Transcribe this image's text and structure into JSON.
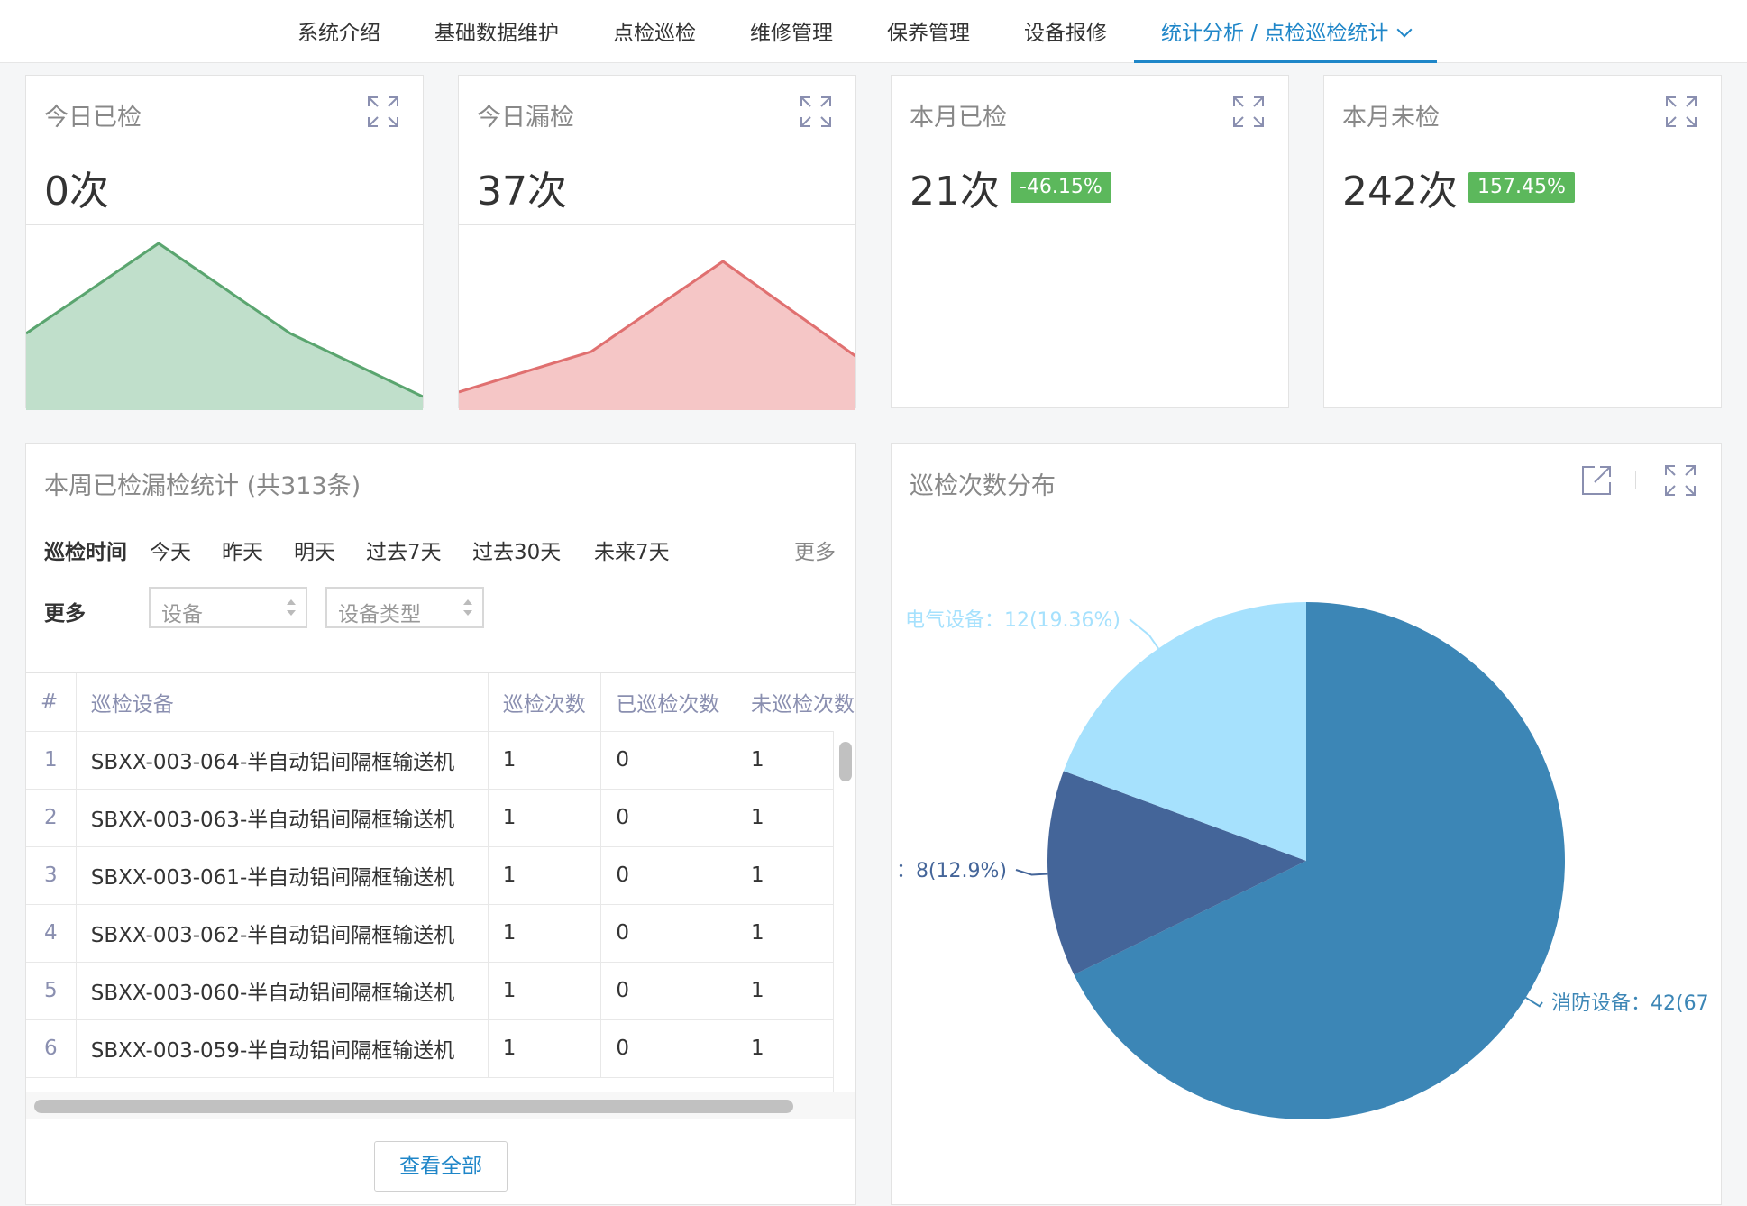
{
  "nav": {
    "items": [
      "系统介绍",
      "基础数据维护",
      "点检巡检",
      "维修管理",
      "保养管理",
      "设备报修"
    ],
    "active": "统计分析 / 点检巡检统计"
  },
  "stats": [
    {
      "title": "今日已检",
      "value": "0次",
      "badge": ""
    },
    {
      "title": "今日漏检",
      "value": "37次",
      "badge": ""
    },
    {
      "title": "本月已检",
      "value": "21次",
      "badge": "-46.15%"
    },
    {
      "title": "本月未检",
      "value": "242次",
      "badge": "157.45%"
    }
  ],
  "colors": {
    "accent": "#1f86c8",
    "spark_green_line": "#5aa56f",
    "spark_green_fill": "#c0dfcb",
    "spark_red_line": "#e07070",
    "spark_red_fill": "#f5c6c6",
    "badge": "#5cb85c",
    "pie_fire": "#3c86b6",
    "pie_electric": "#a6e1fd",
    "pie_other": "#446599"
  },
  "table": {
    "title": "本周已检漏检统计 (共313条)",
    "filter_time_label": "巡检时间",
    "filter_time_options": [
      "今天",
      "昨天",
      "明天",
      "过去7天",
      "过去30天",
      "未来7天"
    ],
    "filter_more_link": "更多",
    "filter_more_label": "更多",
    "select_device_placeholder": "设备",
    "select_type_placeholder": "设备类型",
    "headers": [
      "#",
      "巡检设备",
      "巡检次数",
      "已巡检次数",
      "未巡检次数"
    ],
    "rows": [
      [
        "1",
        "SBXX-003-064-半自动铝间隔框输送机",
        "1",
        "0",
        "1"
      ],
      [
        "2",
        "SBXX-003-063-半自动铝间隔框输送机",
        "1",
        "0",
        "1"
      ],
      [
        "3",
        "SBXX-003-061-半自动铝间隔框输送机",
        "1",
        "0",
        "1"
      ],
      [
        "4",
        "SBXX-003-062-半自动铝间隔框输送机",
        "1",
        "0",
        "1"
      ],
      [
        "5",
        "SBXX-003-060-半自动铝间隔框输送机",
        "1",
        "0",
        "1"
      ],
      [
        "6",
        "SBXX-003-059-半自动铝间隔框输送机",
        "1",
        "0",
        "1"
      ]
    ],
    "view_all": "查看全部"
  },
  "pie_card": {
    "title": "巡检次数分布"
  },
  "chart_data": {
    "type": "pie",
    "slices": [
      {
        "name": "消防设备",
        "value": 42,
        "label": "消防设备：42(67"
      },
      {
        "name": "",
        "value": 8,
        "label": "：8(12.9%)"
      },
      {
        "name": "电气设备",
        "value": 12,
        "label": "电气设备：12(19.36%)"
      }
    ]
  }
}
